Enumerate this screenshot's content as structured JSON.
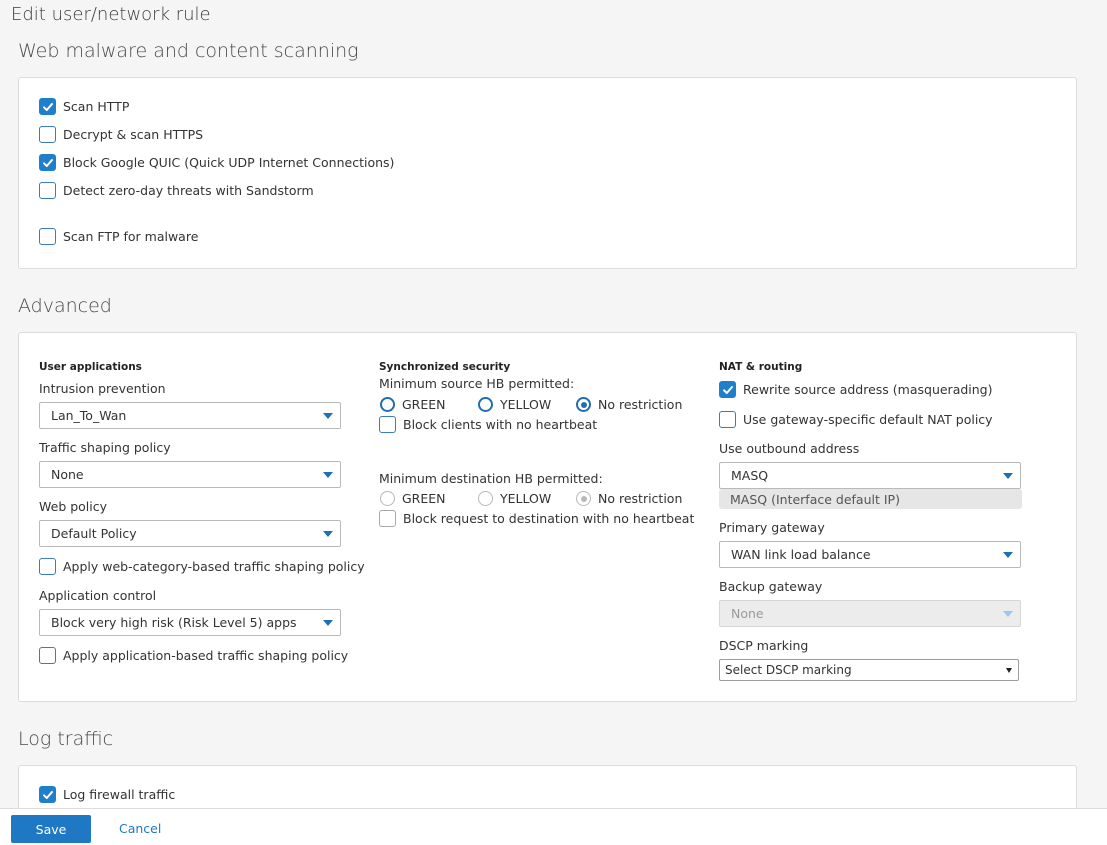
{
  "page": {
    "title": "Edit user/network rule"
  },
  "web_scanning": {
    "title": "Web malware and content scanning",
    "options": [
      {
        "label": "Scan HTTP",
        "checked": true
      },
      {
        "label": "Decrypt & scan HTTPS",
        "checked": false
      },
      {
        "label": "Block Google QUIC (Quick UDP Internet Connections)",
        "checked": true
      },
      {
        "label": "Detect zero-day threats with Sandstorm",
        "checked": false
      },
      {
        "label": "Scan FTP for malware",
        "checked": false
      }
    ]
  },
  "advanced": {
    "title": "Advanced",
    "user_apps": {
      "heading": "User applications",
      "intrusion_label": "Intrusion prevention",
      "intrusion_value": "Lan_To_Wan",
      "shaping_label": "Traffic shaping policy",
      "shaping_value": "None",
      "web_policy_label": "Web policy",
      "web_policy_value": "Default Policy",
      "web_cat_shaping": {
        "label": "Apply web-category-based traffic shaping policy",
        "checked": false
      },
      "app_control_label": "Application control",
      "app_control_value": "Block very high risk (Risk Level 5) apps",
      "app_shaping": {
        "label": "Apply application-based traffic shaping policy",
        "checked": false
      }
    },
    "sync_security": {
      "heading": "Synchronized security",
      "source_label": "Minimum source HB permitted:",
      "source_options": [
        "GREEN",
        "YELLOW",
        "No restriction"
      ],
      "source_selected": "No restriction",
      "block_no_hb": {
        "label": "Block clients with no heartbeat",
        "checked": false
      },
      "dest_label": "Minimum destination HB permitted:",
      "dest_options": [
        "GREEN",
        "YELLOW",
        "No restriction"
      ],
      "dest_selected": "No restriction",
      "block_dest_no_hb": {
        "label": "Block request to destination with no heartbeat",
        "checked": false
      }
    },
    "nat": {
      "heading": "NAT & routing",
      "rewrite": {
        "label": "Rewrite source address (masquerading)",
        "checked": true
      },
      "gateway_nat": {
        "label": "Use gateway-specific default NAT policy",
        "checked": false
      },
      "outbound_label": "Use outbound address",
      "outbound_value": "MASQ",
      "outbound_hint": "MASQ (Interface default IP)",
      "primary_label": "Primary gateway",
      "primary_value": "WAN link load balance",
      "backup_label": "Backup gateway",
      "backup_value": "None",
      "dscp_label": "DSCP marking",
      "dscp_value": "Select DSCP marking"
    }
  },
  "log": {
    "title": "Log traffic",
    "log_firewall": {
      "label": "Log firewall traffic",
      "checked": true
    }
  },
  "footer": {
    "save_label": "Save",
    "cancel_label": "Cancel"
  }
}
